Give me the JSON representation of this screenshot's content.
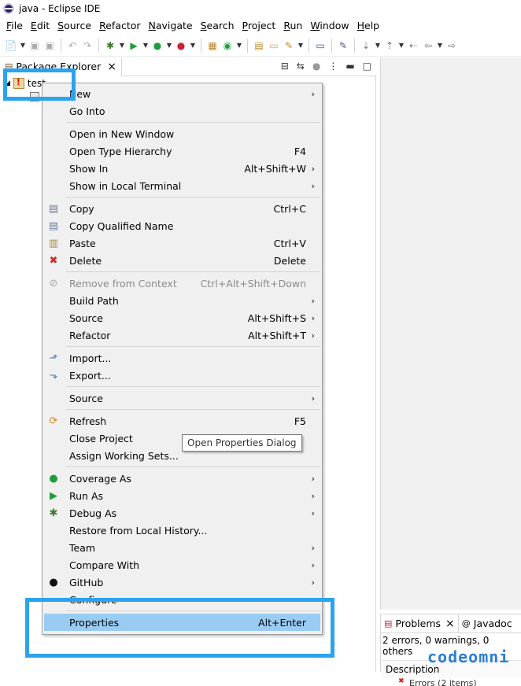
{
  "window": {
    "title": "java - Eclipse IDE"
  },
  "menubar": [
    "File",
    "Edit",
    "Source",
    "Refactor",
    "Navigate",
    "Search",
    "Project",
    "Run",
    "Window",
    "Help"
  ],
  "package_explorer": {
    "tab_label": "Package Explorer",
    "project_name": "test"
  },
  "context_menu": {
    "groups": [
      [
        {
          "label": "New",
          "accel": "",
          "submenu": true,
          "icon": "",
          "name": "menu-new"
        },
        {
          "label": "Go Into",
          "accel": "",
          "submenu": false,
          "icon": "",
          "name": "menu-go-into"
        }
      ],
      [
        {
          "label": "Open in New Window",
          "accel": "",
          "submenu": false,
          "icon": "",
          "name": "menu-open-in-new-window"
        },
        {
          "label": "Open Type Hierarchy",
          "accel": "F4",
          "submenu": false,
          "icon": "",
          "name": "menu-open-type-hierarchy"
        },
        {
          "label": "Show In",
          "accel": "Alt+Shift+W",
          "submenu": true,
          "icon": "",
          "name": "menu-show-in"
        },
        {
          "label": "Show in Local Terminal",
          "accel": "",
          "submenu": true,
          "icon": "",
          "name": "menu-show-in-local-terminal"
        }
      ],
      [
        {
          "label": "Copy",
          "accel": "Ctrl+C",
          "submenu": false,
          "icon": "copy-icon",
          "name": "menu-copy"
        },
        {
          "label": "Copy Qualified Name",
          "accel": "",
          "submenu": false,
          "icon": "copy-qualified-name-icon",
          "name": "menu-copy-qualified-name"
        },
        {
          "label": "Paste",
          "accel": "Ctrl+V",
          "submenu": false,
          "icon": "paste-icon",
          "name": "menu-paste"
        },
        {
          "label": "Delete",
          "accel": "Delete",
          "submenu": false,
          "icon": "delete-icon",
          "name": "menu-delete"
        }
      ],
      [
        {
          "label": "Remove from Context",
          "accel": "Ctrl+Alt+Shift+Down",
          "submenu": false,
          "icon": "remove-context-icon",
          "disabled": true,
          "name": "menu-remove-from-context"
        },
        {
          "label": "Build Path",
          "accel": "",
          "submenu": true,
          "icon": "",
          "name": "menu-build-path"
        },
        {
          "label": "Source",
          "accel": "Alt+Shift+S",
          "submenu": true,
          "icon": "",
          "name": "menu-source"
        },
        {
          "label": "Refactor",
          "accel": "Alt+Shift+T",
          "submenu": true,
          "icon": "",
          "name": "menu-refactor"
        }
      ],
      [
        {
          "label": "Import...",
          "accel": "",
          "submenu": false,
          "icon": "import-icon",
          "name": "menu-import"
        },
        {
          "label": "Export...",
          "accel": "",
          "submenu": false,
          "icon": "export-icon",
          "name": "menu-export"
        }
      ],
      [
        {
          "label": "Source",
          "accel": "",
          "submenu": true,
          "icon": "",
          "name": "menu-source-2"
        }
      ],
      [
        {
          "label": "Refresh",
          "accel": "F5",
          "submenu": false,
          "icon": "refresh-icon",
          "name": "menu-refresh"
        },
        {
          "label": "Close Project",
          "accel": "",
          "submenu": false,
          "icon": "",
          "name": "menu-close-project"
        },
        {
          "label": "Assign Working Sets...",
          "accel": "",
          "submenu": false,
          "icon": "",
          "name": "menu-assign-working-sets"
        }
      ],
      [
        {
          "label": "Coverage As",
          "accel": "",
          "submenu": true,
          "icon": "coverage-icon",
          "name": "menu-coverage-as"
        },
        {
          "label": "Run As",
          "accel": "",
          "submenu": true,
          "icon": "run-icon",
          "name": "menu-run-as"
        },
        {
          "label": "Debug As",
          "accel": "",
          "submenu": true,
          "icon": "debug-icon",
          "name": "menu-debug-as"
        },
        {
          "label": "Restore from Local History...",
          "accel": "",
          "submenu": false,
          "icon": "",
          "name": "menu-restore-local-history"
        },
        {
          "label": "Team",
          "accel": "",
          "submenu": true,
          "icon": "",
          "name": "menu-team"
        },
        {
          "label": "Compare With",
          "accel": "",
          "submenu": true,
          "icon": "",
          "name": "menu-compare-with"
        },
        {
          "label": "GitHub",
          "accel": "",
          "submenu": true,
          "icon": "github-icon",
          "name": "menu-github"
        },
        {
          "label": "Configure",
          "accel": "",
          "submenu": true,
          "icon": "",
          "name": "menu-configure"
        }
      ],
      [
        {
          "label": "Properties",
          "accel": "Alt+Enter",
          "submenu": false,
          "icon": "",
          "highlight": true,
          "name": "menu-properties"
        }
      ]
    ]
  },
  "tooltip": "Open Properties Dialog",
  "bottom_panel": {
    "tab_problems": "Problems",
    "tab_javadoc": "Javadoc",
    "summary": "2 errors, 0 warnings, 0 others",
    "column_description": "Description",
    "errors_row": "Errors (2 items)"
  },
  "watermark": "codeomni",
  "colors": {
    "highlight_box": "#2ba3ef",
    "menu_selection": "#99ccf3",
    "menu_bg": "#f0f0f0"
  }
}
